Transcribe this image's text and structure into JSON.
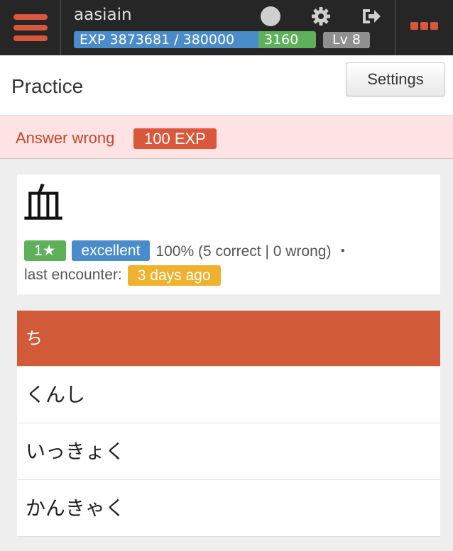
{
  "topbar": {
    "username": "aasiain",
    "exp_label": "EXP 3873681 / 380000",
    "exp_bonus": "3160",
    "level": "Lv 8",
    "icons": [
      "circle-icon",
      "gear-icon",
      "logout-icon",
      "more-icon"
    ],
    "accent_color": "#d9573a"
  },
  "header": {
    "title": "Practice",
    "settings_label": "Settings"
  },
  "alert": {
    "text": "Answer wrong",
    "badge": "100 EXP"
  },
  "card": {
    "kanji": "血",
    "stars": "1★",
    "rating": "excellent",
    "accuracy": "100% (5 correct | 0 wrong)  ・",
    "last_encounter_label": "last encounter:",
    "last_encounter_value": "3 days ago"
  },
  "answers": [
    {
      "text": "ち",
      "state": "wrong"
    },
    {
      "text": "くんし",
      "state": "normal"
    },
    {
      "text": "いっきょく",
      "state": "normal"
    },
    {
      "text": "かんきゃく",
      "state": "normal"
    }
  ]
}
